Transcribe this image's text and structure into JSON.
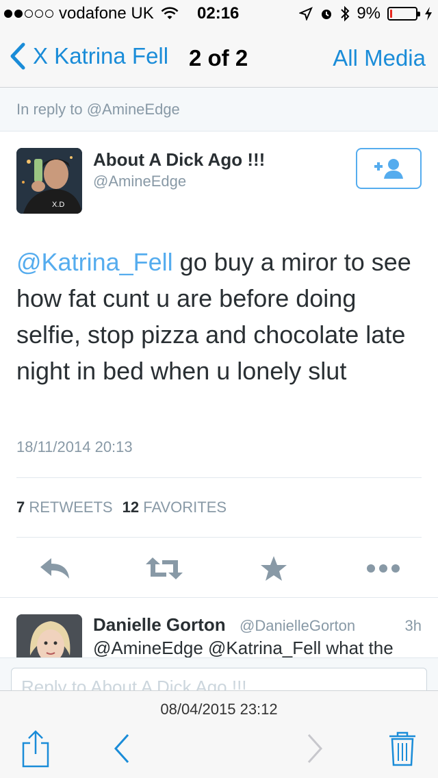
{
  "status_bar": {
    "carrier": "vodafone UK",
    "time": "02:16",
    "battery_text": "9%",
    "battery_level": 0.09,
    "signal_bars": 2,
    "signal_total": 5
  },
  "nav": {
    "back_label": "X Katrina Fell",
    "count": "2 of 2",
    "all_media": "All Media"
  },
  "in_reply": "In reply to @AmineEdge",
  "tweet": {
    "name": "About A Dick Ago !!!",
    "handle": "@AmineEdge",
    "mention": "@Katrina_Fell",
    "text": " go buy a miror to see how fat cunt u are before doing selfie, stop pizza and chocolate late night in bed when u lonely slut",
    "date": "18/11/2014 20:13",
    "retweets_count": "7",
    "retweets_label": "RETWEETS",
    "favorites_count": "12",
    "favorites_label": "FAVORITES"
  },
  "reply": {
    "name": "Danielle Gorton",
    "handle": "@DanielleGorton",
    "time": "3h",
    "text": "@AmineEdge @Katrina_Fell what the"
  },
  "compose": {
    "placeholder": "Reply to About A Dick Ago !!!"
  },
  "toolbar": {
    "date": "08/04/2015 23:12"
  },
  "colors": {
    "accent": "#1a8cd8",
    "twitter_blue": "#55acee",
    "muted": "#8899a6",
    "battery_low": "#e8281f"
  },
  "icons": [
    "back-chevron-icon",
    "follow-user-icon",
    "reply-icon",
    "retweet-icon",
    "favorite-star-icon",
    "more-icon",
    "share-icon",
    "previous-icon",
    "next-icon",
    "trash-icon"
  ]
}
